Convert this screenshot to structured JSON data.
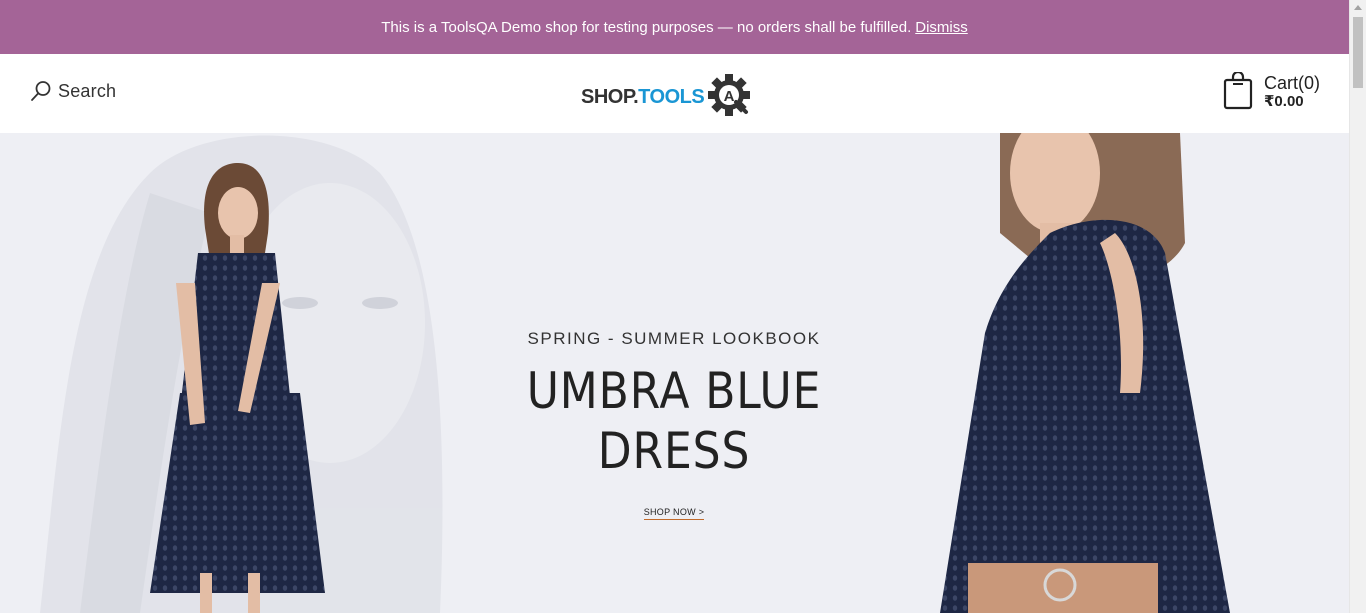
{
  "notice": {
    "message": "This is a ToolsQA Demo shop for testing purposes — no orders shall be fulfilled.",
    "dismiss_label": "Dismiss"
  },
  "header": {
    "search_label": "Search",
    "search_icon": "search-icon",
    "logo": {
      "word_shop": "SHOP.",
      "word_tools": "TOOLS",
      "badge_letter": "A"
    },
    "cart": {
      "icon": "shopping-bag-icon",
      "count_label": "Cart(0)",
      "total": "₹0.00"
    }
  },
  "hero": {
    "subtitle": "SPRING - SUMMER LOOKBOOK",
    "title_line1": "UMBRA BLUE",
    "title_line2": "DRESS",
    "cta_label": "SHOP NOW >"
  },
  "colors": {
    "notice_bg": "#a46497",
    "logo_blue": "#1a96d4",
    "hero_bg": "#eeeff4",
    "dress_navy": "#1e2744",
    "cta_underline": "#c06a2b"
  }
}
